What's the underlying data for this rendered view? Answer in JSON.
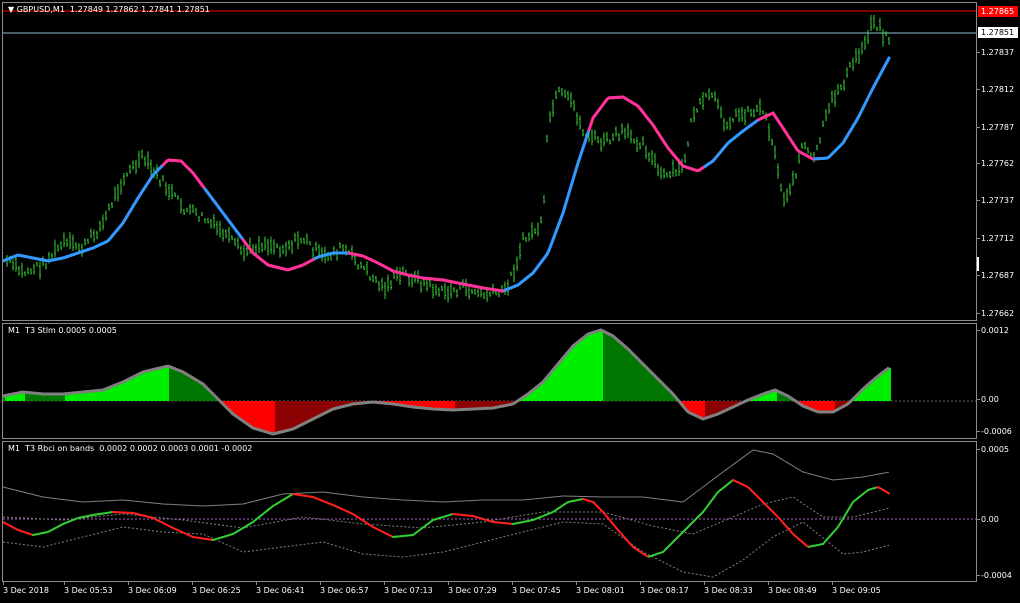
{
  "main": {
    "title": "GBPUSD,M1  1.27849 1.27862 1.27841 1.27851",
    "ask_price": "1.27865",
    "bid_price": "1.27851",
    "price_ticks": [
      "1.27837",
      "1.27812",
      "1.27787",
      "1.27762",
      "1.27737",
      "1.27712",
      "1.27687",
      "1.27662"
    ],
    "colors": {
      "bars": "#33cc33",
      "ma_up": "#3399ff",
      "ma_down": "#ff3399",
      "ask_line": "#ff0000",
      "bid_line": "#8fbfcf"
    }
  },
  "stlm": {
    "title": "M1  T3 Stlm 0.0005 0.0005",
    "ticks": [
      "0.0012",
      "0.00",
      "-0.0006"
    ],
    "colors": {
      "pos_up": "#00ee00",
      "pos_down": "#007700",
      "neg_down": "#ff0000",
      "neg_up": "#8b0000",
      "line": "#808080"
    }
  },
  "rbci": {
    "title": "M1  T3 Rbci on bands  0.0002 0.0002 0.0003 0.0001 -0.0002",
    "ticks": [
      "0.0005",
      "0.00",
      "-0.0004"
    ],
    "colors": {
      "up": "#33cc33",
      "down": "#ff2020",
      "band": "#808080",
      "zero": "#aa66cc"
    }
  },
  "time_axis": [
    "3 Dec 2018",
    "3 Dec 05:53",
    "3 Dec 06:09",
    "3 Dec 06:25",
    "3 Dec 06:41",
    "3 Dec 06:57",
    "3 Dec 07:13",
    "3 Dec 07:29",
    "3 Dec 07:45",
    "3 Dec 08:01",
    "3 Dec 08:17",
    "3 Dec 08:33",
    "3 Dec 08:49",
    "3 Dec 09:05"
  ]
}
